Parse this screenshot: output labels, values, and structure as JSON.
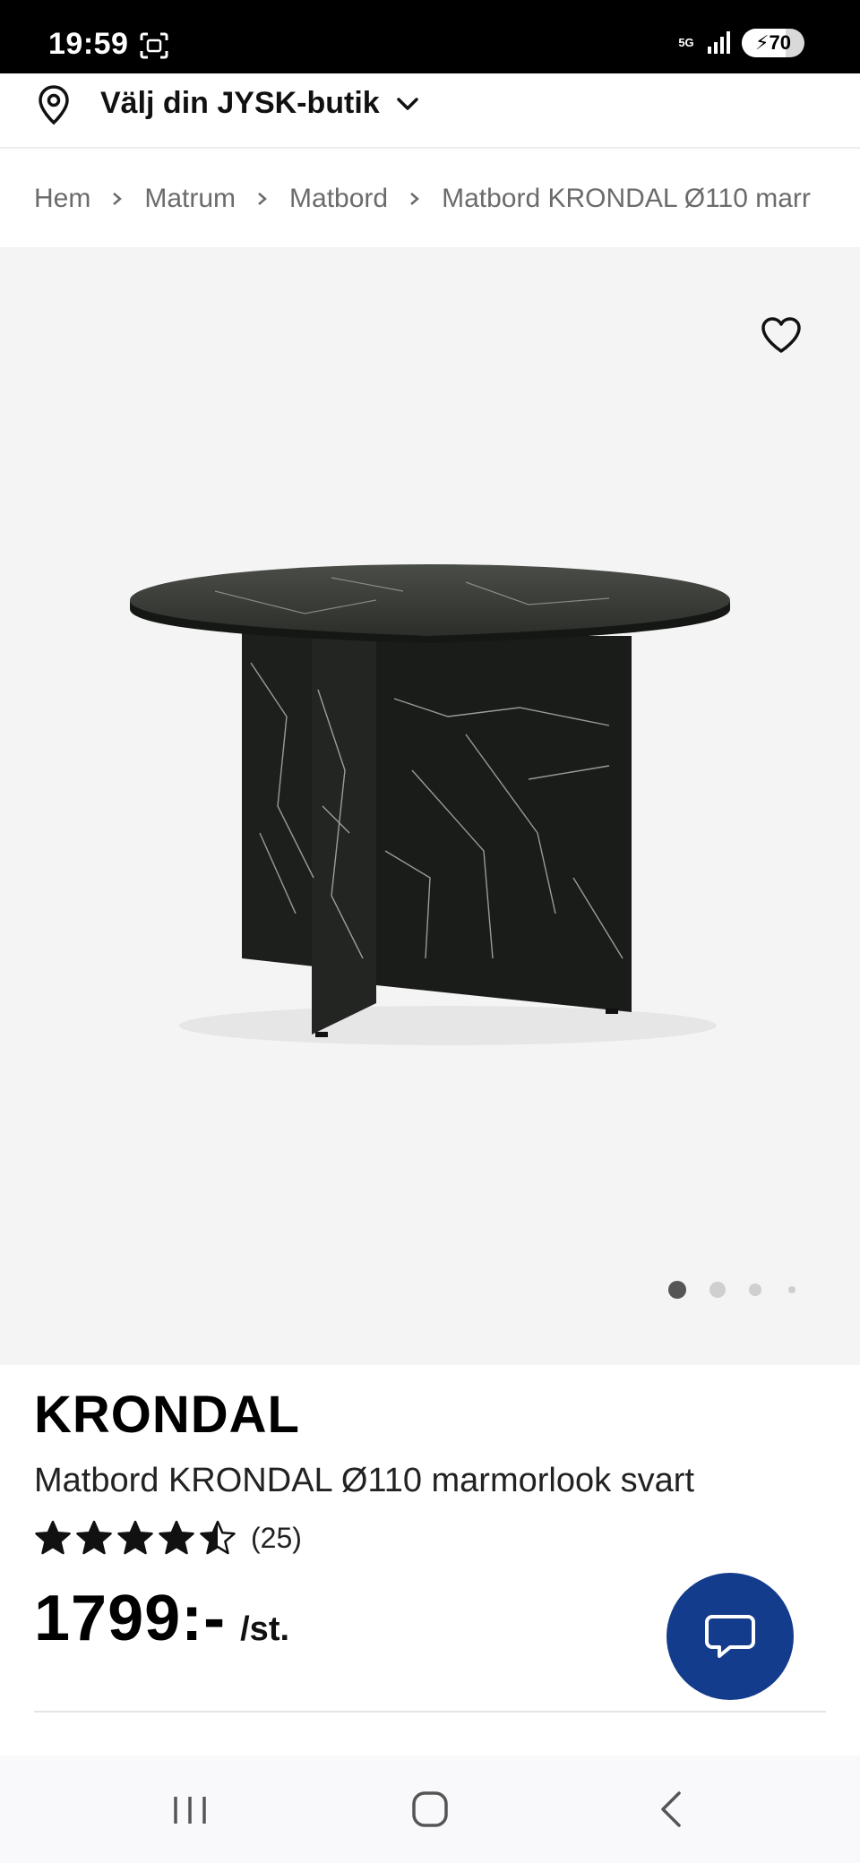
{
  "status_bar": {
    "time": "19:59",
    "network": "5G",
    "battery": "70",
    "battery_level": 0.7
  },
  "store_selector": {
    "label": "Välj din JYSK-butik",
    "icon": "location-pin-icon",
    "chevron": "chevron-down-icon"
  },
  "breadcrumb": {
    "items": [
      "Hem",
      "Matrum",
      "Matbord",
      "Matbord KRONDAL Ø110 marr"
    ]
  },
  "gallery": {
    "favorite_icon": "heart-icon",
    "image_alt": "Matbord KRONDAL Ø110 marmorlook svart",
    "slide_count": 4,
    "active_slide": 1
  },
  "product": {
    "name": "KRONDAL",
    "description": "Matbord KRONDAL Ø110 marmorlook svart",
    "rating": 4.5,
    "rating_count": "(25)",
    "price": "1799:-",
    "unit": "/st."
  },
  "chat": {
    "icon": "chat-bubble-icon"
  },
  "colors": {
    "accent": "#143c8c",
    "gallery_bg": "#f4f4f4",
    "status_bar_bg": "#000000"
  },
  "nav_bar": {
    "recent_icon": "recent-apps-icon",
    "home_icon": "home-icon",
    "back_icon": "back-icon"
  }
}
